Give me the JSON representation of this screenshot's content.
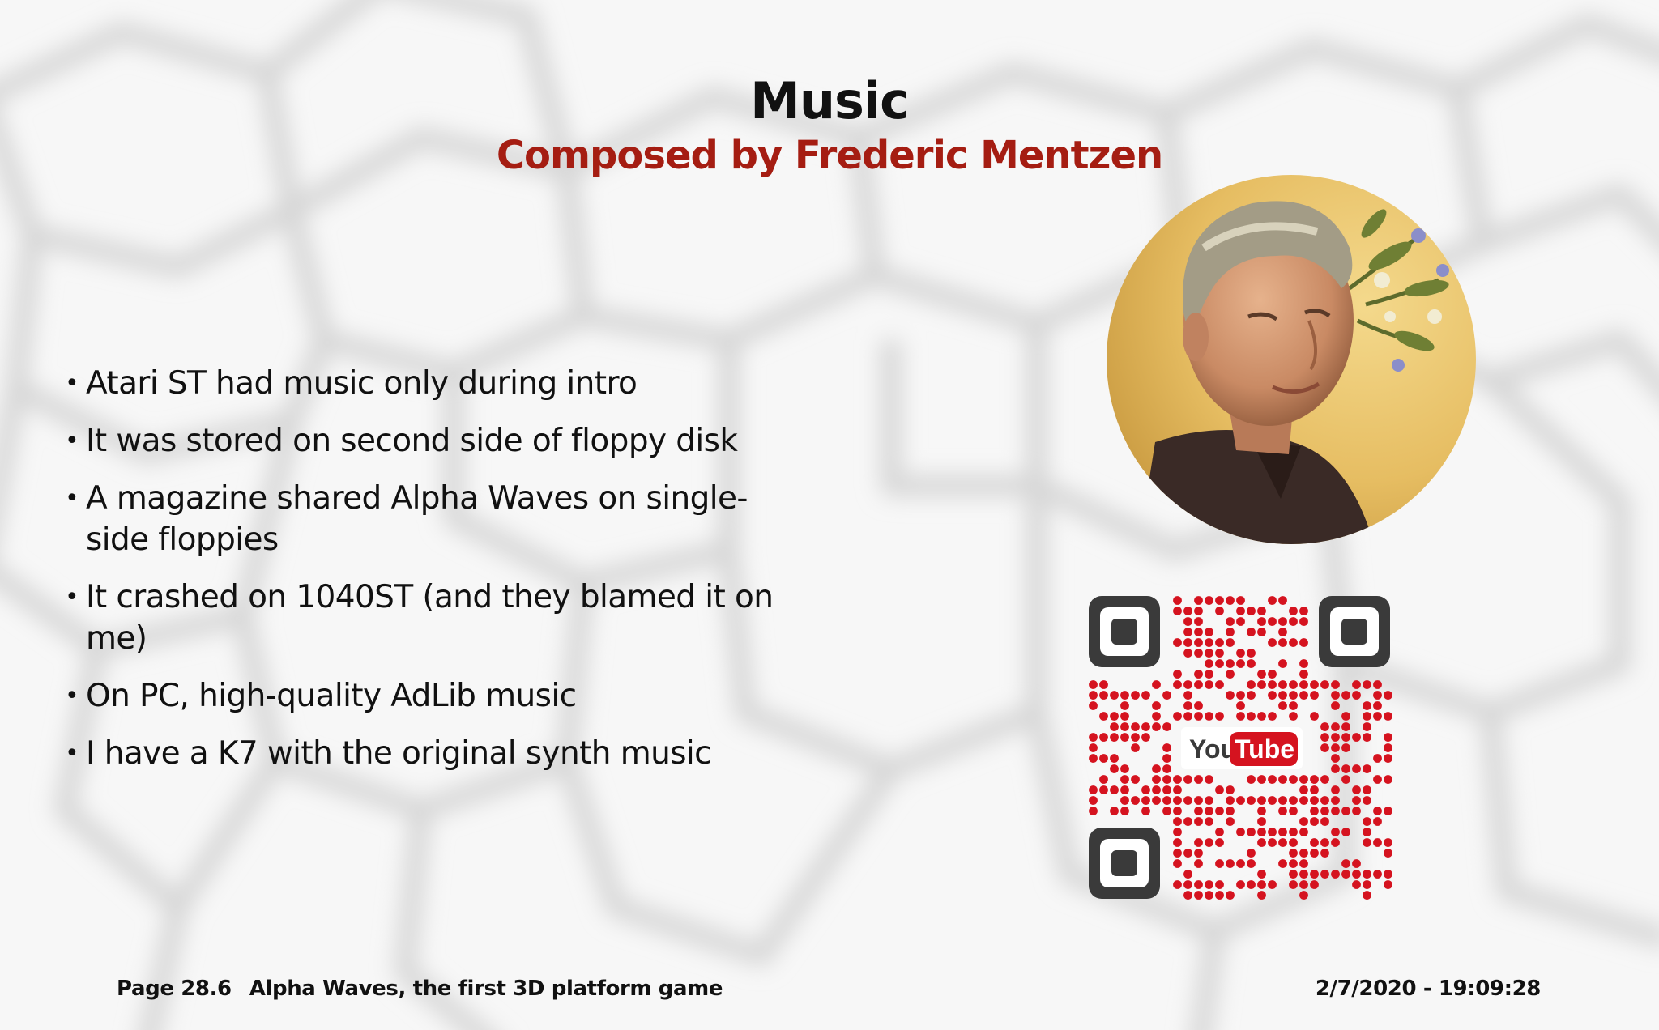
{
  "slide": {
    "title": "Music",
    "subtitle": "Composed by Frederic Mentzen",
    "bullets": [
      "Atari ST had music only during intro",
      "It was stored on second side of floppy disk",
      "A magazine shared Alpha Waves on single-side floppies",
      "It crashed on 1040ST (and they blamed it on me)",
      "On PC, high-quality AdLib music",
      "I have a K7 with the original synth music"
    ],
    "bullet_symbol": "•"
  },
  "qr": {
    "logo_you": "You",
    "logo_tube": "Tube"
  },
  "footer": {
    "page": "Page 28.6",
    "deck_title": "Alpha Waves, the first 3D platform game",
    "timestamp": "2/7/2020 - 19:09:28"
  },
  "colors": {
    "title": "#111111",
    "subtitle": "#a51d12",
    "qr_red": "#d5131f",
    "qr_dark": "#3a3a3a"
  },
  "icons": {
    "qr": "youtube-qr-code-icon",
    "photo": "composer-portrait"
  }
}
